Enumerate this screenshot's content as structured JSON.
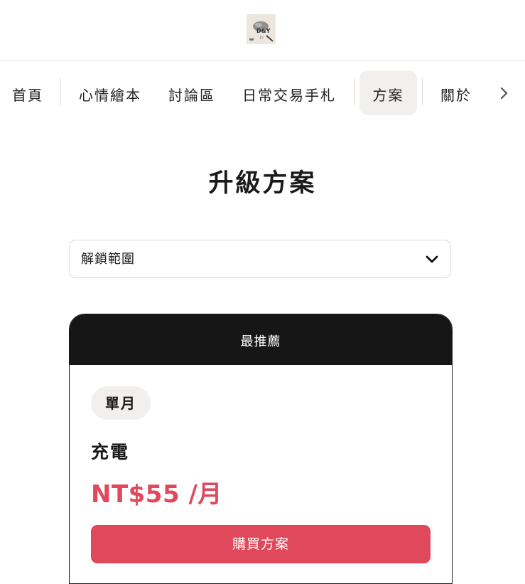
{
  "header": {
    "logo_text": "D&Y",
    "logo_subtext": "Ju"
  },
  "nav": {
    "items": [
      {
        "label": "首頁"
      },
      {
        "label": "心情繪本"
      },
      {
        "label": "討論區"
      },
      {
        "label": "日常交易手札"
      },
      {
        "label": "方案",
        "active": true
      },
      {
        "label": "關於"
      }
    ],
    "next_icon": "chevron-right-icon"
  },
  "main": {
    "title": "升級方案",
    "dropdown": {
      "selected": "解鎖範圍",
      "icon": "chevron-down-icon"
    },
    "plan_card": {
      "banner": "最推薦",
      "period_badge": "單月",
      "name": "充電",
      "price": "NT$55 /月",
      "buy_label": "購買方案"
    }
  },
  "colors": {
    "accent": "#e0485b",
    "banner_bg": "#161616",
    "active_tab_bg": "#f1f0ee"
  }
}
